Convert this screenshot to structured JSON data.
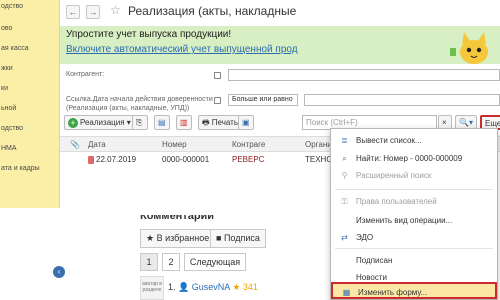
{
  "sidebar": {
    "items": [
      "одство",
      "ово",
      "ая касса",
      "жки",
      "ки",
      "ьной",
      "одство",
      "НМА",
      "ата и кадры"
    ]
  },
  "window": {
    "back_glyph": "←",
    "forward_glyph": "→",
    "star_glyph": "☆",
    "title": "Реализация (акты, накладные"
  },
  "banner": {
    "title": "Упростите учет выпуска продукции!",
    "link": "Включите автоматический учет выпущенной прод"
  },
  "filters": {
    "contractor_label": "Контрагент:",
    "link_label": "Ссылка.Дата начала действия доверенности (Реализация (акты, накладные, УПД))",
    "condition_value": "Больше или равно"
  },
  "toolbar": {
    "realization_label": "Реализация",
    "print_label": "Печать",
    "search_placeholder": "Поиск (Ctrl+F)",
    "more_label": "Еще"
  },
  "table": {
    "headers": [
      "Дата",
      "Номер",
      "Контраге",
      "Организация"
    ],
    "rows": [
      [
        "22.07.2019",
        "0000-000001",
        "РЕВЕРС",
        "ТЕХНОМИР"
      ]
    ]
  },
  "comments": {
    "title": "Комментарии",
    "favorites_label": "В избранное",
    "subscribe_label": "Подписа",
    "pages": [
      "1",
      "2"
    ],
    "next_label": "Следующая",
    "author_box": "аватар в разделе",
    "comment_index": "1.",
    "user": "GusevNA",
    "rating": "341"
  },
  "menu": {
    "items": [
      {
        "label": "Вывести список...",
        "enabled": true,
        "icon": "list-icon"
      },
      {
        "label": "Найти: Номер - 0000-000009",
        "enabled": true,
        "icon": "find-icon"
      },
      {
        "label": "Расширенный поиск",
        "enabled": false,
        "icon": "extended-search-icon"
      },
      {
        "label": "Права пользователей",
        "enabled": false,
        "icon": "rights-icon"
      },
      {
        "label": "Изменить вид операции...",
        "enabled": true,
        "icon": ""
      },
      {
        "label": "ЭДО",
        "enabled": true,
        "icon": "edo-icon"
      },
      {
        "label": "Подписан",
        "enabled": true,
        "icon": ""
      },
      {
        "label": "Новости",
        "enabled": true,
        "icon": ""
      },
      {
        "label": "Изменить форму...",
        "enabled": true,
        "icon": "change-form-icon"
      }
    ]
  },
  "colors": {
    "sidebar_bg": "#fbeea7",
    "banner_bg": "#d7efc3",
    "highlight_border": "#cc2b2b",
    "highlight_bg": "#fce8a6"
  }
}
